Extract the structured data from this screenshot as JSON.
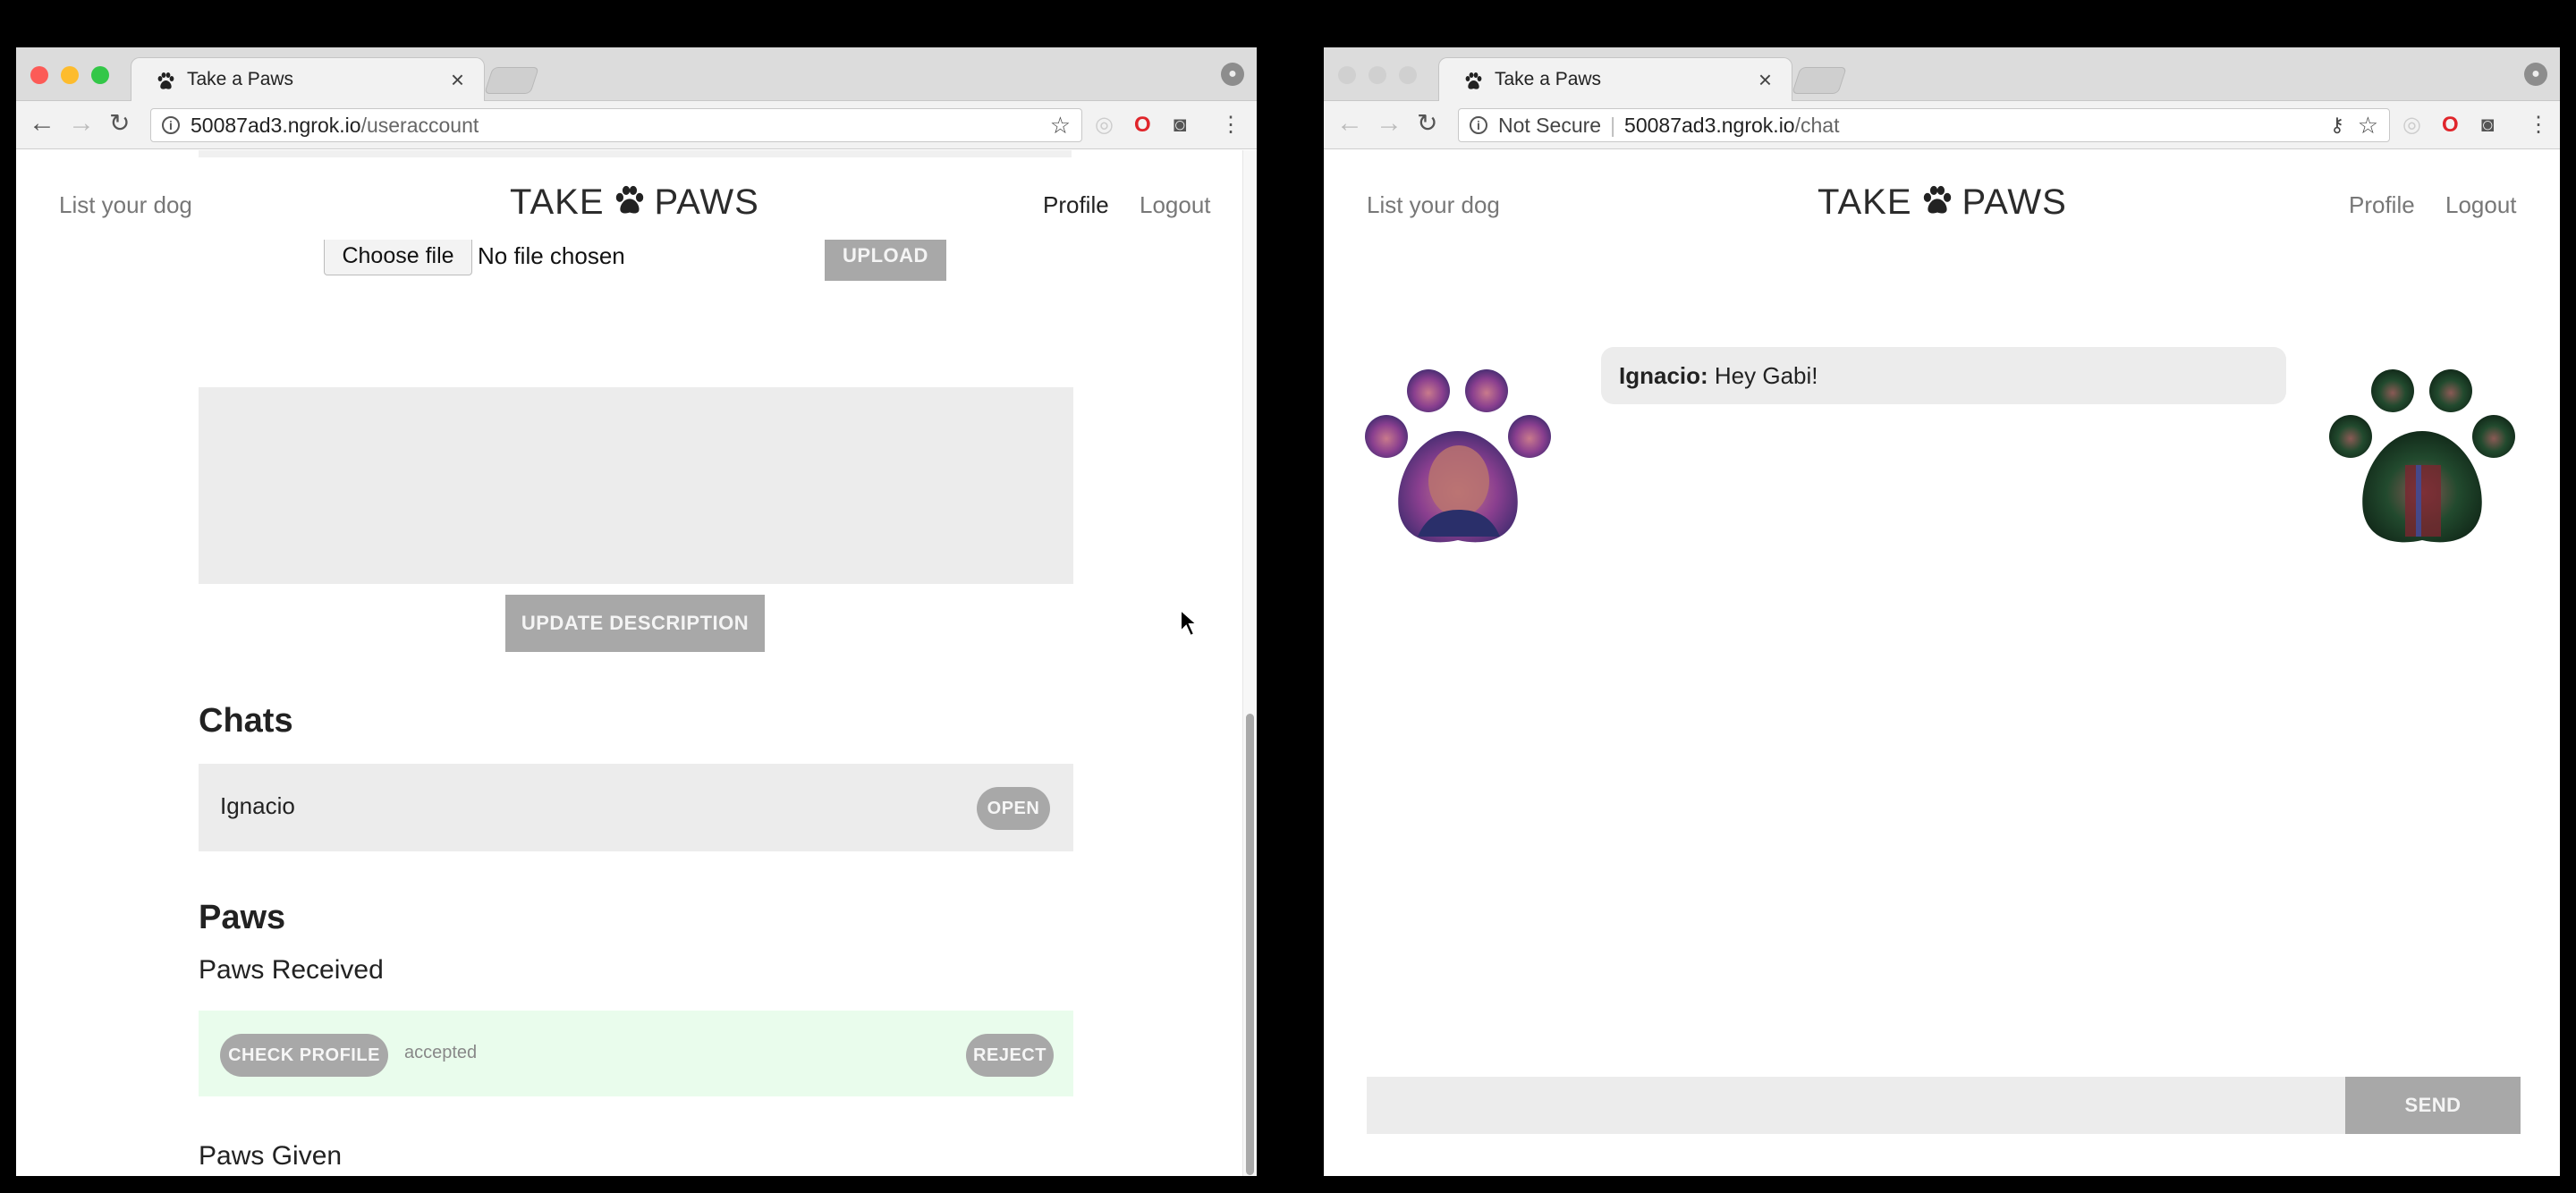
{
  "left": {
    "tab_title": "Take a Paws",
    "url_host": "50087ad3.ngrok.io",
    "url_path": "/useraccount",
    "nav": {
      "list_dog": "List your dog",
      "profile": "Profile",
      "logout": "Logout"
    },
    "logo": {
      "left": "TAKE",
      "right": "PAWS"
    },
    "file": {
      "choose": "Choose file",
      "status": "No file chosen",
      "upload": "UPLOAD"
    },
    "description": {
      "value": "",
      "button": "UPDATE DESCRIPTION"
    },
    "chats": {
      "heading": "Chats",
      "items": [
        {
          "name": "Ignacio",
          "button": "OPEN"
        }
      ]
    },
    "paws": {
      "heading": "Paws",
      "received_heading": "Paws Received",
      "received": [
        {
          "check": "CHECK PROFILE",
          "status": "accepted",
          "reject": "REJECT"
        }
      ],
      "given_heading": "Paws Given"
    }
  },
  "right": {
    "tab_title": "Take a Paws",
    "security": "Not Secure",
    "url_host": "50087ad3.ngrok.io",
    "url_path": "/chat",
    "nav": {
      "list_dog": "List your dog",
      "profile": "Profile",
      "logout": "Logout"
    },
    "logo": {
      "left": "TAKE",
      "right": "PAWS"
    },
    "messages": [
      {
        "sender": "Ignacio:",
        "text": "Hey Gabi!"
      }
    ],
    "input": {
      "value": "",
      "send": "SEND"
    }
  },
  "colors": {
    "accent_gray": "#a8a8a8",
    "accepted_bg": "#e9fcec",
    "panel_gray": "#ececec"
  }
}
